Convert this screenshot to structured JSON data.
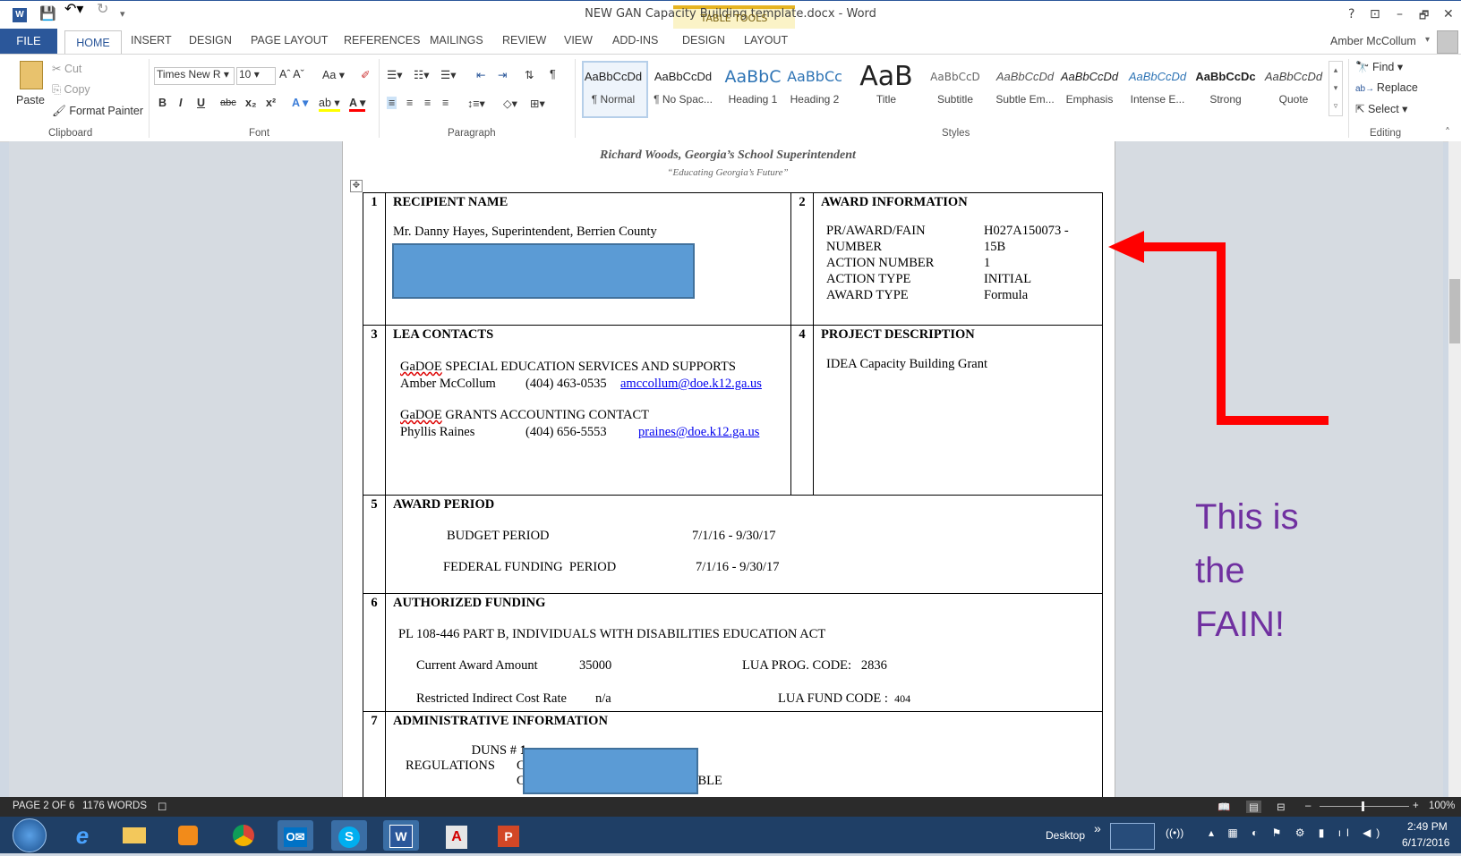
{
  "window": {
    "title": "NEW GAN Capacity Building template.docx - Word",
    "contextual_group": "TABLE TOOLS",
    "help": "?",
    "controls": {
      "restore_ribbon": "⊡",
      "minimize": "–",
      "maximize": "🗗",
      "close": "✕"
    }
  },
  "tabs": [
    "FILE",
    "HOME",
    "INSERT",
    "DESIGN",
    "PAGE LAYOUT",
    "REFERENCES",
    "MAILINGS",
    "REVIEW",
    "VIEW",
    "ADD-INS",
    "DESIGN",
    "LAYOUT"
  ],
  "user": {
    "name": "Amber McCollum"
  },
  "ribbon": {
    "clipboard": {
      "paste": "Paste",
      "cut": "Cut",
      "copy": "Copy",
      "format_painter": "Format Painter",
      "label": "Clipboard"
    },
    "font": {
      "name": "Times New R",
      "size": "10",
      "label": "Font"
    },
    "paragraph": {
      "label": "Paragraph"
    },
    "styles": {
      "label": "Styles",
      "items": [
        {
          "sample": "AaBbCcDd",
          "name": "¶ Normal"
        },
        {
          "sample": "AaBbCcDd",
          "name": "¶ No Spac..."
        },
        {
          "sample": "AaBbC",
          "name": "Heading 1"
        },
        {
          "sample": "AaBbCc",
          "name": "Heading 2"
        },
        {
          "sample": "AaB",
          "name": "Title"
        },
        {
          "sample": "AaBbCcD",
          "name": "Subtitle"
        },
        {
          "sample": "AaBbCcDd",
          "name": "Subtle Em..."
        },
        {
          "sample": "AaBbCcDd",
          "name": "Emphasis"
        },
        {
          "sample": "AaBbCcDd",
          "name": "Intense E..."
        },
        {
          "sample": "AaBbCcDc",
          "name": "Strong"
        },
        {
          "sample": "AaBbCcDd",
          "name": "Quote"
        }
      ]
    },
    "editing": {
      "find": "Find",
      "replace": "Replace",
      "select": "Select",
      "label": "Editing"
    }
  },
  "document": {
    "header_line1": "Richard Woods, Georgia’s School Superintendent",
    "header_line2": "“Educating Georgia’s Future”",
    "sections": {
      "s1": {
        "num": "1",
        "title": "RECIPIENT NAME",
        "line": "Mr. Danny Hayes, Superintendent, Berrien County"
      },
      "s2": {
        "num": "2",
        "title": "AWARD INFORMATION",
        "rows": [
          {
            "k": "PR/AWARD/FAIN",
            "v": "H027A150073 -"
          },
          {
            "k": "NUMBER",
            "v": "15B"
          },
          {
            "k": "ACTION NUMBER",
            "v": "1"
          },
          {
            "k": "ACTION TYPE",
            "v": "INITIAL"
          },
          {
            "k": "AWARD TYPE",
            "v": "Formula"
          }
        ]
      },
      "s3": {
        "num": "3",
        "title": "LEA CONTACTS",
        "c1_org_a": "GaDOE",
        "c1_org_b": " SPECIAL EDUCATION SERVICES AND SUPPORTS",
        "c1_name": "Amber McCollum",
        "c1_phone": "(404) 463-0535",
        "c1_email": "amccollum@doe.k12.ga.us",
        "c2_org_a": "GaDOE",
        "c2_org_b": " GRANTS ACCOUNTING CONTACT",
        "c2_name": "Phyllis Raines",
        "c2_phone": "(404) 656-5553",
        "c2_email": "praines@doe.k12.ga.us"
      },
      "s4": {
        "num": "4",
        "title": "PROJECT DESCRIPTION",
        "text": "IDEA Capacity Building Grant"
      },
      "s5": {
        "num": "5",
        "title": "AWARD PERIOD",
        "budget_label": "BUDGET PERIOD",
        "budget_value": "7/1/16 - 9/30/17",
        "federal_label": "FEDERAL FUNDING  PERIOD",
        "federal_value": "7/1/16 - 9/30/17"
      },
      "s6": {
        "num": "6",
        "title": "AUTHORIZED FUNDING",
        "law": "PL 108-446 PART B, INDIVIDUALS WITH DISABILITIES EDUCATION ACT",
        "amount_label": "Current Award Amount",
        "amount_value": "35000",
        "prog_code": "LUA PROG. CODE:   2836",
        "rate_label": "Restricted Indirect Cost Rate",
        "rate_value": "n/a",
        "fund_code_label": "LUA FUND CODE :",
        "fund_code_value": "404"
      },
      "s7": {
        "num": "7",
        "title": "ADMINISTRATIVE INFORMATION",
        "duns_label": "DUNS #",
        "duns_frag": "1",
        "regs_label": "REGULATIONS",
        "regs_frag": "C",
        "line3_frag_a": "C",
        "line3_frag_b": "ABLE"
      }
    }
  },
  "annotation": {
    "line1": "This is",
    "line2": "the",
    "line3": "FAIN!",
    "arrow_color": "#ff0000",
    "text_color": "#7030a0"
  },
  "status": {
    "page": "PAGE 2 OF 6",
    "words": "1176 WORDS",
    "zoom": "100%"
  },
  "taskbar": {
    "desktop": "Desktop",
    "time": "2:49 PM",
    "date": "6/17/2016"
  },
  "colors": {
    "word_blue": "#2b579a",
    "redaction": "#5b9bd5"
  }
}
